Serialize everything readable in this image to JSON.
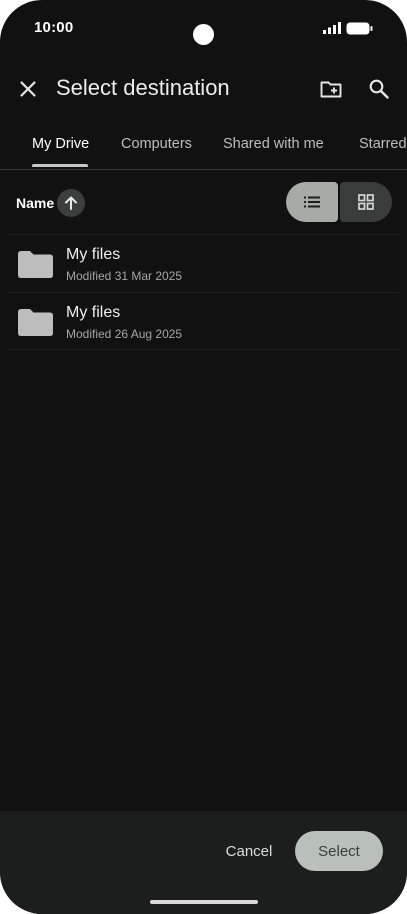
{
  "status_bar": {
    "time": "10:00"
  },
  "app_bar": {
    "title": "Select destination"
  },
  "tabs": [
    {
      "label": "My Drive",
      "active": true
    },
    {
      "label": "Computers",
      "active": false
    },
    {
      "label": "Shared with me",
      "active": false
    },
    {
      "label": "Starred",
      "active": false
    }
  ],
  "sort": {
    "label": "Name",
    "direction": "ascending"
  },
  "view_mode": "list",
  "files": [
    {
      "name": "My files",
      "modified": "Modified 31 Mar 2025"
    },
    {
      "name": "My files",
      "modified": "Modified 26 Aug 2025"
    }
  ],
  "bottom_bar": {
    "cancel_label": "Cancel",
    "select_label": "Select"
  },
  "icons": [
    "close-icon",
    "new-folder-icon",
    "search-icon",
    "arrow-up-icon",
    "list-view-icon",
    "grid-view-icon",
    "folder-icon"
  ],
  "colors": {
    "background": "#111111",
    "select_button": "#b9bfbb",
    "active_view": "#a8aaa8"
  }
}
